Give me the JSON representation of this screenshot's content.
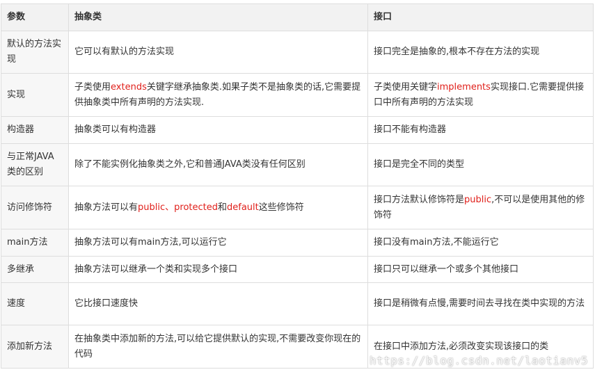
{
  "table": {
    "headers": [
      "参数",
      "抽象类",
      "接口"
    ],
    "rows": [
      {
        "param": "默认的方法实现",
        "abstract": [
          {
            "t": "它可以有默认的方法实现"
          }
        ],
        "iface": [
          {
            "t": "接口完全是抽象的,根本不存在方法的实现"
          }
        ]
      },
      {
        "param": "实现",
        "abstract": [
          {
            "t": "子类使用"
          },
          {
            "t": "extends",
            "hl": true
          },
          {
            "t": "关键字继承抽象类.如果子类不是抽象类的话,它需要提供抽象类中所有声明的方法实现."
          }
        ],
        "iface": [
          {
            "t": "子类使用关键字"
          },
          {
            "t": "implements",
            "hl": true
          },
          {
            "t": "实现接口.它需要提供接口中所有声明的方法实现"
          }
        ]
      },
      {
        "param": "构造器",
        "abstract": [
          {
            "t": "抽象类可以有构造器"
          }
        ],
        "iface": [
          {
            "t": "接口不能有构造器"
          }
        ]
      },
      {
        "param": "与正常JAVA类的区别",
        "abstract": [
          {
            "t": "除了不能实例化抽象类之外,它和普通JAVA类没有任何区别"
          }
        ],
        "iface": [
          {
            "t": "接口是完全不同的类型"
          }
        ]
      },
      {
        "param": "访问修饰符",
        "abstract": [
          {
            "t": "抽象方法可以有"
          },
          {
            "t": "public、protected",
            "hl": true
          },
          {
            "t": "和"
          },
          {
            "t": "default",
            "hl": true
          },
          {
            "t": "这些修饰符"
          }
        ],
        "iface": [
          {
            "t": "接口方法默认修饰符是"
          },
          {
            "t": "public",
            "hl": true
          },
          {
            "t": ",不可以是使用其他的修饰符"
          }
        ]
      },
      {
        "param": "main方法",
        "abstract": [
          {
            "t": "抽象方法可以有main方法,可以运行它"
          }
        ],
        "iface": [
          {
            "t": "接口没有main方法,不能运行它"
          }
        ]
      },
      {
        "param": "多继承",
        "abstract": [
          {
            "t": "抽象方法可以继承一个类和实现多个接口"
          }
        ],
        "iface": [
          {
            "t": "接口只可以继承一个或多个其他接口"
          }
        ]
      },
      {
        "param": "速度",
        "abstract": [
          {
            "t": "它比接口速度快"
          }
        ],
        "iface": [
          {
            "t": "接口是稍微有点慢,需要时间去寻找在类中实现的方法"
          }
        ]
      },
      {
        "param": "添加新方法",
        "abstract": [
          {
            "t": "在抽象类中添加新的方法,可以给它提供默认的实现,不需要改变你现在的代码"
          }
        ],
        "iface": [
          {
            "t": "在接口中添加方法,必须改变实现该接口的类"
          }
        ]
      }
    ]
  },
  "watermark": "https://blog.csdn.net/laotianv5",
  "colors": {
    "highlight": "#e0201b",
    "header_bg": "#f2f2f2",
    "border": "#dddddd"
  }
}
